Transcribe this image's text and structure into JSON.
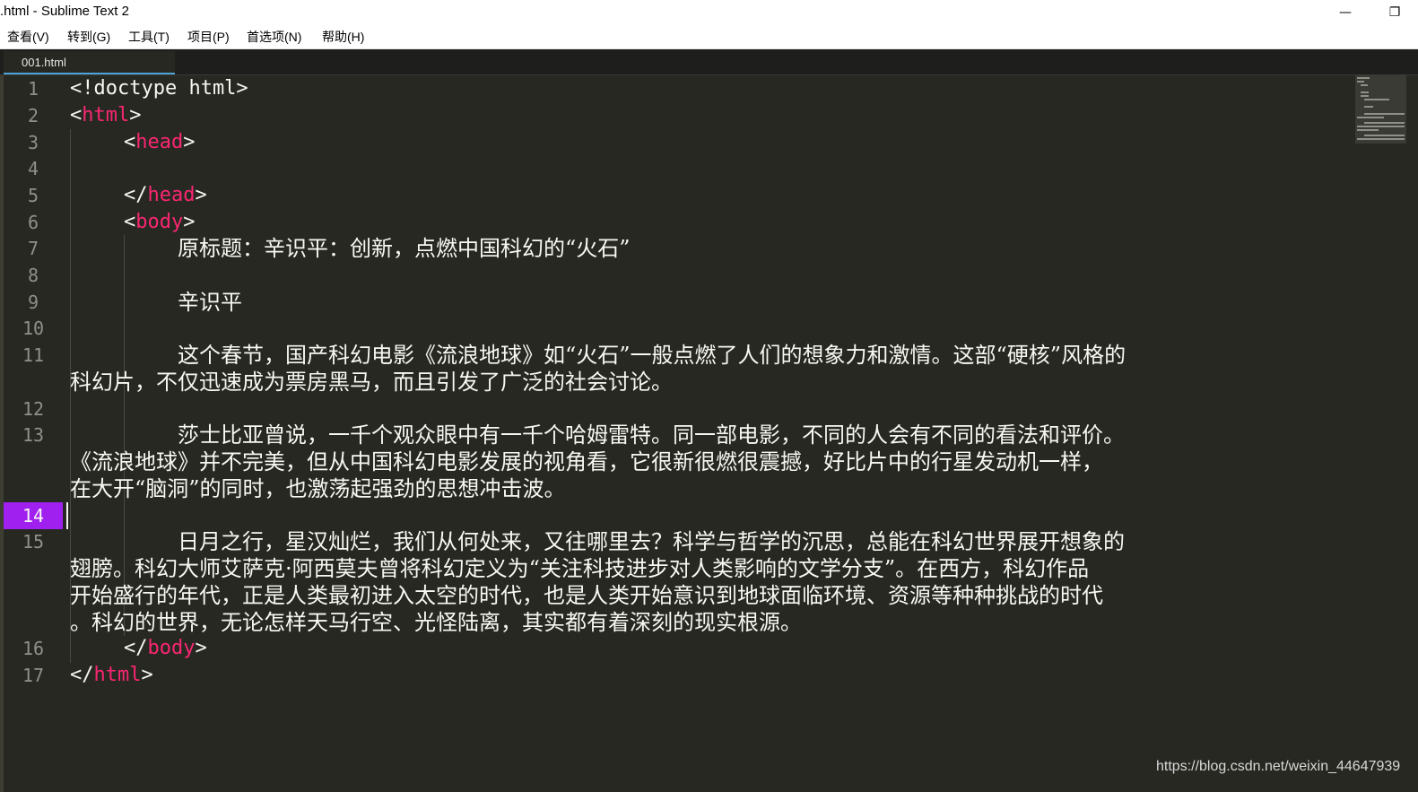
{
  "window": {
    "title": ".html - Sublime Text 2",
    "minimize_glyph": "—",
    "restore_glyph": "❐"
  },
  "menu": {
    "items": [
      "查看(V)",
      "转到(G)",
      "工具(T)",
      "项目(P)",
      "首选项(N)",
      "帮助(H)"
    ]
  },
  "tabs": [
    {
      "label": "001.html",
      "active": true
    }
  ],
  "gutter": {
    "active_line": 14,
    "line_numbers": [
      "1",
      "2",
      "3",
      "4",
      "5",
      "6",
      "7",
      "8",
      "9",
      "10",
      "11",
      "12",
      "13",
      "14",
      "15",
      "16",
      "17"
    ]
  },
  "code": {
    "line1": "<!doctype html>",
    "line2_open": "<",
    "line2_tag": "html",
    "line2_close": ">",
    "line3_open": "<",
    "line3_tag": "head",
    "line3_close": ">",
    "line5_open": "</",
    "line5_tag": "head",
    "line5_close": ">",
    "line6_open": "<",
    "line6_tag": "body",
    "line6_close": ">",
    "line7": "原标题：辛识平：创新，点燃中国科幻的“火石”",
    "line9": "辛识平",
    "line11_a": "这个春节，国产科幻电影《流浪地球》如“火石”一般点燃了人们的想象力和激情。这部“硬核”风格的",
    "line11_b": "科幻片，不仅迅速成为票房黑马，而且引发了广泛的社会讨论。",
    "line13_a": "莎士比亚曾说，一千个观众眼中有一千个哈姆雷特。同一部电影，不同的人会有不同的看法和评价。",
    "line13_b": "《流浪地球》并不完美，但从中国科幻电影发展的视角看，它很新很燃很震撼，好比片中的行星发动机一样，",
    "line13_c": "在大开“脑洞”的同时，也激荡起强劲的思想冲击波。",
    "line15_a": "日月之行，星汉灿烂，我们从何处来，又往哪里去？科学与哲学的沉思，总能在科幻世界展开想象的",
    "line15_b": "翅膀。科幻大师艾萨克·阿西莫夫曾将科幻定义为“关注科技进步对人类影响的文学分支”。在西方，科幻作品",
    "line15_c": "开始盛行的年代，正是人类最初进入太空的时代，也是人类开始意识到地球面临环境、资源等种种挑战的时代",
    "line15_d": "。科幻的世界，无论怎样天马行空、光怪陆离，其实都有着深刻的现实根源。",
    "line16_open": "</",
    "line16_tag": "body",
    "line16_close": ">",
    "line17_open": "</",
    "line17_tag": "html",
    "line17_close": ">"
  },
  "watermark": "https://blog.csdn.net/weixin_44647939",
  "colors": {
    "background": "#272822",
    "tag": "#f92672",
    "text": "#f8f8f2",
    "line_number": "#90908a",
    "active_line_highlight": "#a020f0",
    "tab_underline": "#4ea3d8"
  }
}
